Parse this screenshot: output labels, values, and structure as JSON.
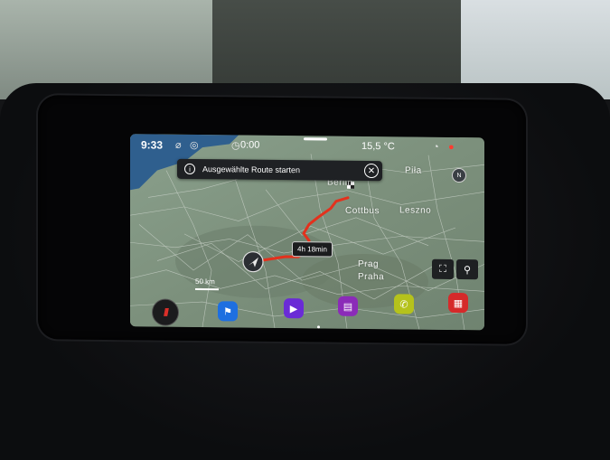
{
  "status_bar": {
    "time": "9:33",
    "stopwatch": "0:00",
    "temperature": "15,5 °C",
    "icons": [
      "mute-icon",
      "globe-icon",
      "clock-icon",
      "wireless-icon",
      "notification-icon"
    ]
  },
  "banner": {
    "message": "Ausgewählte Route starten",
    "info_icon": "info-icon",
    "close_icon": "close-icon"
  },
  "map": {
    "labels": {
      "berlin": "Berlin",
      "cottbus": "Cottbus",
      "leszno": "Leszno",
      "pila": "Piła",
      "prag": "Prag",
      "praha": "Praha"
    },
    "route_duration": "4h 18min",
    "scale": "50 km",
    "colors": {
      "route": "#e3311d",
      "map_land": "#7d8f7c"
    }
  },
  "map_controls": {
    "overview_icon": "route-overview-icon",
    "poi_icon": "poi-search-icon",
    "compass_icon": "compass-icon"
  },
  "dock": {
    "home_icon": "home-menu-icon",
    "items": [
      {
        "name": "navigation",
        "icon": "flag-icon",
        "color": "#1e6fe0"
      },
      {
        "name": "media",
        "icon": "play-icon",
        "color": "#6a2bd6"
      },
      {
        "name": "radio",
        "icon": "radio-icon",
        "color": "#8b2bb8"
      },
      {
        "name": "phone",
        "icon": "phone-icon",
        "color": "#b5c21c"
      },
      {
        "name": "vehicle",
        "icon": "car-icon",
        "color": "#d52a2a"
      }
    ]
  }
}
